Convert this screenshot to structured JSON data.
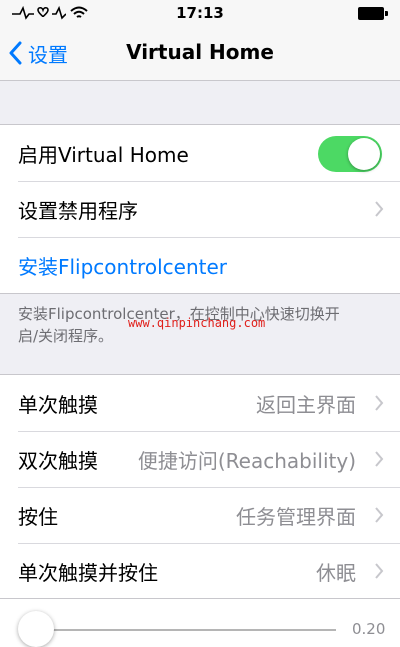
{
  "status_bar": {
    "time": "17:13"
  },
  "nav": {
    "back_label": "设置",
    "title": "Virtual Home"
  },
  "settings": {
    "enable_label": "启用Virtual Home",
    "enable_on": true,
    "disabled_apps_label": "设置禁用程序",
    "install_label": "安装Flipcontrolcenter"
  },
  "footer": {
    "line1": "安装Flipcontrolcenter，在控制中心快速切换开",
    "line2": "启/关闭程序。"
  },
  "watermark": "www.qinpinchang.com",
  "actions": [
    {
      "label": "单次触摸",
      "value": "返回主界面"
    },
    {
      "label": "双次触摸",
      "value": "便捷访问(Reachability)"
    },
    {
      "label": "按住",
      "value": "任务管理界面"
    },
    {
      "label": "单次触摸并按住",
      "value": "休眠"
    }
  ],
  "slider": {
    "value_text": "0.20",
    "fraction": 0.0
  },
  "colors": {
    "accent": "#007aff",
    "toggle_on": "#4cd964",
    "background": "#efeff4"
  }
}
